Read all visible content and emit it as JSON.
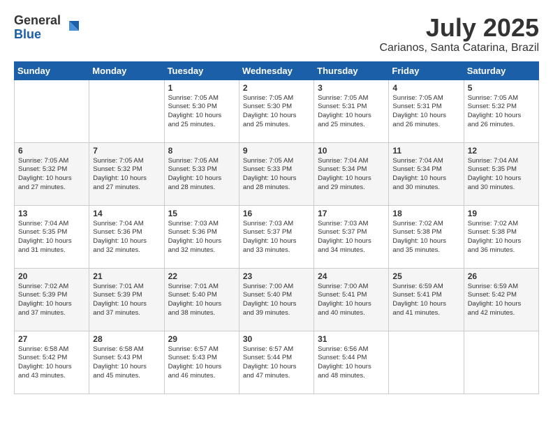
{
  "header": {
    "logo_general": "General",
    "logo_blue": "Blue",
    "month_year": "July 2025",
    "location": "Carianos, Santa Catarina, Brazil"
  },
  "days_of_week": [
    "Sunday",
    "Monday",
    "Tuesday",
    "Wednesday",
    "Thursday",
    "Friday",
    "Saturday"
  ],
  "weeks": [
    [
      {
        "day": "",
        "info": ""
      },
      {
        "day": "",
        "info": ""
      },
      {
        "day": "1",
        "info": "Sunrise: 7:05 AM\nSunset: 5:30 PM\nDaylight: 10 hours\nand 25 minutes."
      },
      {
        "day": "2",
        "info": "Sunrise: 7:05 AM\nSunset: 5:30 PM\nDaylight: 10 hours\nand 25 minutes."
      },
      {
        "day": "3",
        "info": "Sunrise: 7:05 AM\nSunset: 5:31 PM\nDaylight: 10 hours\nand 25 minutes."
      },
      {
        "day": "4",
        "info": "Sunrise: 7:05 AM\nSunset: 5:31 PM\nDaylight: 10 hours\nand 26 minutes."
      },
      {
        "day": "5",
        "info": "Sunrise: 7:05 AM\nSunset: 5:32 PM\nDaylight: 10 hours\nand 26 minutes."
      }
    ],
    [
      {
        "day": "6",
        "info": "Sunrise: 7:05 AM\nSunset: 5:32 PM\nDaylight: 10 hours\nand 27 minutes."
      },
      {
        "day": "7",
        "info": "Sunrise: 7:05 AM\nSunset: 5:32 PM\nDaylight: 10 hours\nand 27 minutes."
      },
      {
        "day": "8",
        "info": "Sunrise: 7:05 AM\nSunset: 5:33 PM\nDaylight: 10 hours\nand 28 minutes."
      },
      {
        "day": "9",
        "info": "Sunrise: 7:05 AM\nSunset: 5:33 PM\nDaylight: 10 hours\nand 28 minutes."
      },
      {
        "day": "10",
        "info": "Sunrise: 7:04 AM\nSunset: 5:34 PM\nDaylight: 10 hours\nand 29 minutes."
      },
      {
        "day": "11",
        "info": "Sunrise: 7:04 AM\nSunset: 5:34 PM\nDaylight: 10 hours\nand 30 minutes."
      },
      {
        "day": "12",
        "info": "Sunrise: 7:04 AM\nSunset: 5:35 PM\nDaylight: 10 hours\nand 30 minutes."
      }
    ],
    [
      {
        "day": "13",
        "info": "Sunrise: 7:04 AM\nSunset: 5:35 PM\nDaylight: 10 hours\nand 31 minutes."
      },
      {
        "day": "14",
        "info": "Sunrise: 7:04 AM\nSunset: 5:36 PM\nDaylight: 10 hours\nand 32 minutes."
      },
      {
        "day": "15",
        "info": "Sunrise: 7:03 AM\nSunset: 5:36 PM\nDaylight: 10 hours\nand 32 minutes."
      },
      {
        "day": "16",
        "info": "Sunrise: 7:03 AM\nSunset: 5:37 PM\nDaylight: 10 hours\nand 33 minutes."
      },
      {
        "day": "17",
        "info": "Sunrise: 7:03 AM\nSunset: 5:37 PM\nDaylight: 10 hours\nand 34 minutes."
      },
      {
        "day": "18",
        "info": "Sunrise: 7:02 AM\nSunset: 5:38 PM\nDaylight: 10 hours\nand 35 minutes."
      },
      {
        "day": "19",
        "info": "Sunrise: 7:02 AM\nSunset: 5:38 PM\nDaylight: 10 hours\nand 36 minutes."
      }
    ],
    [
      {
        "day": "20",
        "info": "Sunrise: 7:02 AM\nSunset: 5:39 PM\nDaylight: 10 hours\nand 37 minutes."
      },
      {
        "day": "21",
        "info": "Sunrise: 7:01 AM\nSunset: 5:39 PM\nDaylight: 10 hours\nand 37 minutes."
      },
      {
        "day": "22",
        "info": "Sunrise: 7:01 AM\nSunset: 5:40 PM\nDaylight: 10 hours\nand 38 minutes."
      },
      {
        "day": "23",
        "info": "Sunrise: 7:00 AM\nSunset: 5:40 PM\nDaylight: 10 hours\nand 39 minutes."
      },
      {
        "day": "24",
        "info": "Sunrise: 7:00 AM\nSunset: 5:41 PM\nDaylight: 10 hours\nand 40 minutes."
      },
      {
        "day": "25",
        "info": "Sunrise: 6:59 AM\nSunset: 5:41 PM\nDaylight: 10 hours\nand 41 minutes."
      },
      {
        "day": "26",
        "info": "Sunrise: 6:59 AM\nSunset: 5:42 PM\nDaylight: 10 hours\nand 42 minutes."
      }
    ],
    [
      {
        "day": "27",
        "info": "Sunrise: 6:58 AM\nSunset: 5:42 PM\nDaylight: 10 hours\nand 43 minutes."
      },
      {
        "day": "28",
        "info": "Sunrise: 6:58 AM\nSunset: 5:43 PM\nDaylight: 10 hours\nand 45 minutes."
      },
      {
        "day": "29",
        "info": "Sunrise: 6:57 AM\nSunset: 5:43 PM\nDaylight: 10 hours\nand 46 minutes."
      },
      {
        "day": "30",
        "info": "Sunrise: 6:57 AM\nSunset: 5:44 PM\nDaylight: 10 hours\nand 47 minutes."
      },
      {
        "day": "31",
        "info": "Sunrise: 6:56 AM\nSunset: 5:44 PM\nDaylight: 10 hours\nand 48 minutes."
      },
      {
        "day": "",
        "info": ""
      },
      {
        "day": "",
        "info": ""
      }
    ]
  ]
}
